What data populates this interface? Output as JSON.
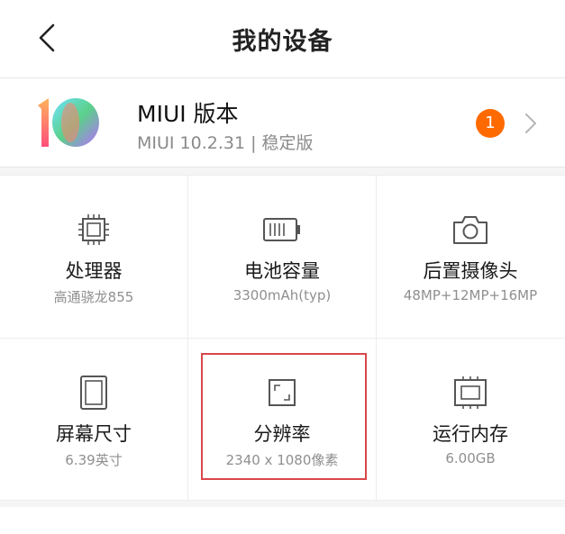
{
  "header": {
    "title": "我的设备",
    "back_icon": "chevron-left-icon"
  },
  "miui": {
    "title": "MIUI 版本",
    "subtitle": "MIUI 10.2.31 | 稳定版",
    "badge_count": "1",
    "logo_text": "10",
    "colors": {
      "badge": "#ff6a00",
      "logo_one": "#ff5a6b",
      "logo_zero_a": "#7fd8ff",
      "logo_zero_b": "#b07cff"
    }
  },
  "specs": [
    {
      "name": "处理器",
      "value": "高通骁龙855",
      "icon": "chip-icon"
    },
    {
      "name": "电池容量",
      "value": "3300mAh(typ)",
      "icon": "battery-icon"
    },
    {
      "name": "后置摄像头",
      "value": "48MP+12MP+16MP",
      "icon": "camera-icon"
    },
    {
      "name": "屏幕尺寸",
      "value": "6.39英寸",
      "icon": "screen-icon"
    },
    {
      "name": "分辨率",
      "value": "2340 x 1080像素",
      "icon": "resolution-icon"
    },
    {
      "name": "运行内存",
      "value": "6.00GB",
      "icon": "memory-icon"
    }
  ],
  "highlight_color": "#d9474b"
}
